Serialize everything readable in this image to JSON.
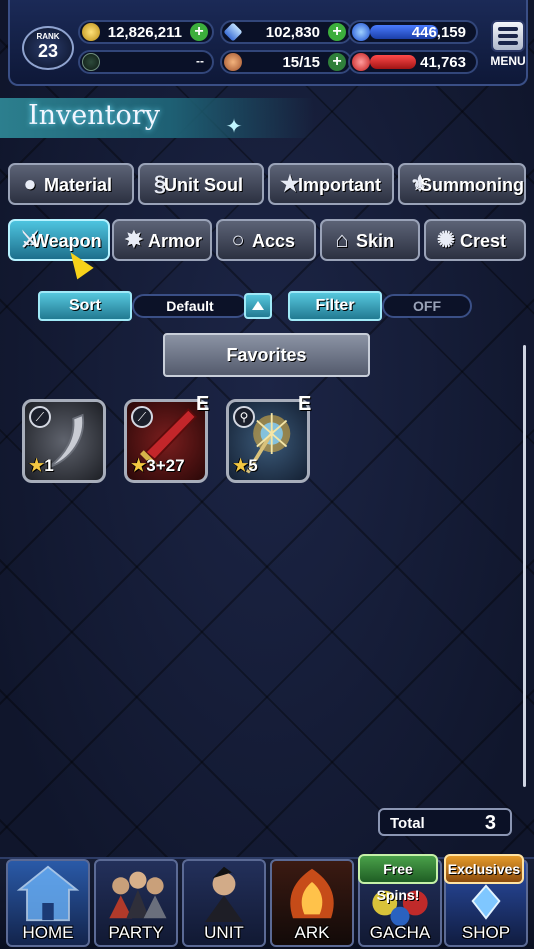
{
  "topbar": {
    "rank_label": "RANK",
    "rank_value": "23",
    "gil": "12,826,211",
    "gems": "102,830",
    "exp": "446,159",
    "energy_value": "--",
    "stamina": "15/15",
    "hp": "41,763",
    "menu_label": "MENU"
  },
  "header": {
    "title": "Inventory"
  },
  "categories": [
    {
      "label": "Material",
      "icon": "bag-icon"
    },
    {
      "label": "Unit Soul",
      "icon": "soul-icon"
    },
    {
      "label": "Important",
      "icon": "star-icon"
    },
    {
      "label": "Summoning",
      "icon": "summon-icon"
    }
  ],
  "equip_tabs": [
    {
      "label": "Weapon",
      "icon": "sword-icon",
      "active": true
    },
    {
      "label": "Armor",
      "icon": "armor-icon"
    },
    {
      "label": "Accs",
      "icon": "ring-icon"
    },
    {
      "label": "Skin",
      "icon": "hanger-icon"
    },
    {
      "label": "Crest",
      "icon": "crest-icon"
    }
  ],
  "controls": {
    "sort_label": "Sort",
    "sort_value": "Default",
    "filter_label": "Filter",
    "filter_value": "OFF",
    "favorites_label": "Favorites"
  },
  "items": [
    {
      "type_icon": "dagger-icon",
      "stars": "1",
      "plus": "",
      "equipped": false,
      "equip_mark": "",
      "color": "#3a3d44"
    },
    {
      "type_icon": "sword-icon",
      "stars": "3",
      "plus": "+27",
      "equipped": true,
      "equip_mark": "E",
      "color": "#5a1414"
    },
    {
      "type_icon": "staff-icon",
      "stars": "5",
      "plus": "",
      "equipped": true,
      "equip_mark": "E",
      "color": "#2a3b52"
    }
  ],
  "total": {
    "label": "Total",
    "value": "3"
  },
  "nav": [
    {
      "label": "HOME"
    },
    {
      "label": "PARTY"
    },
    {
      "label": "UNIT"
    },
    {
      "label": "ARK"
    },
    {
      "label": "GACHA",
      "tag": "Free Spins!"
    },
    {
      "label": "SHOP",
      "tag": "Exclusives"
    }
  ],
  "colors": {
    "accent": "#4ec4df",
    "gold": "#f4c842",
    "green": "#3cae3c"
  }
}
